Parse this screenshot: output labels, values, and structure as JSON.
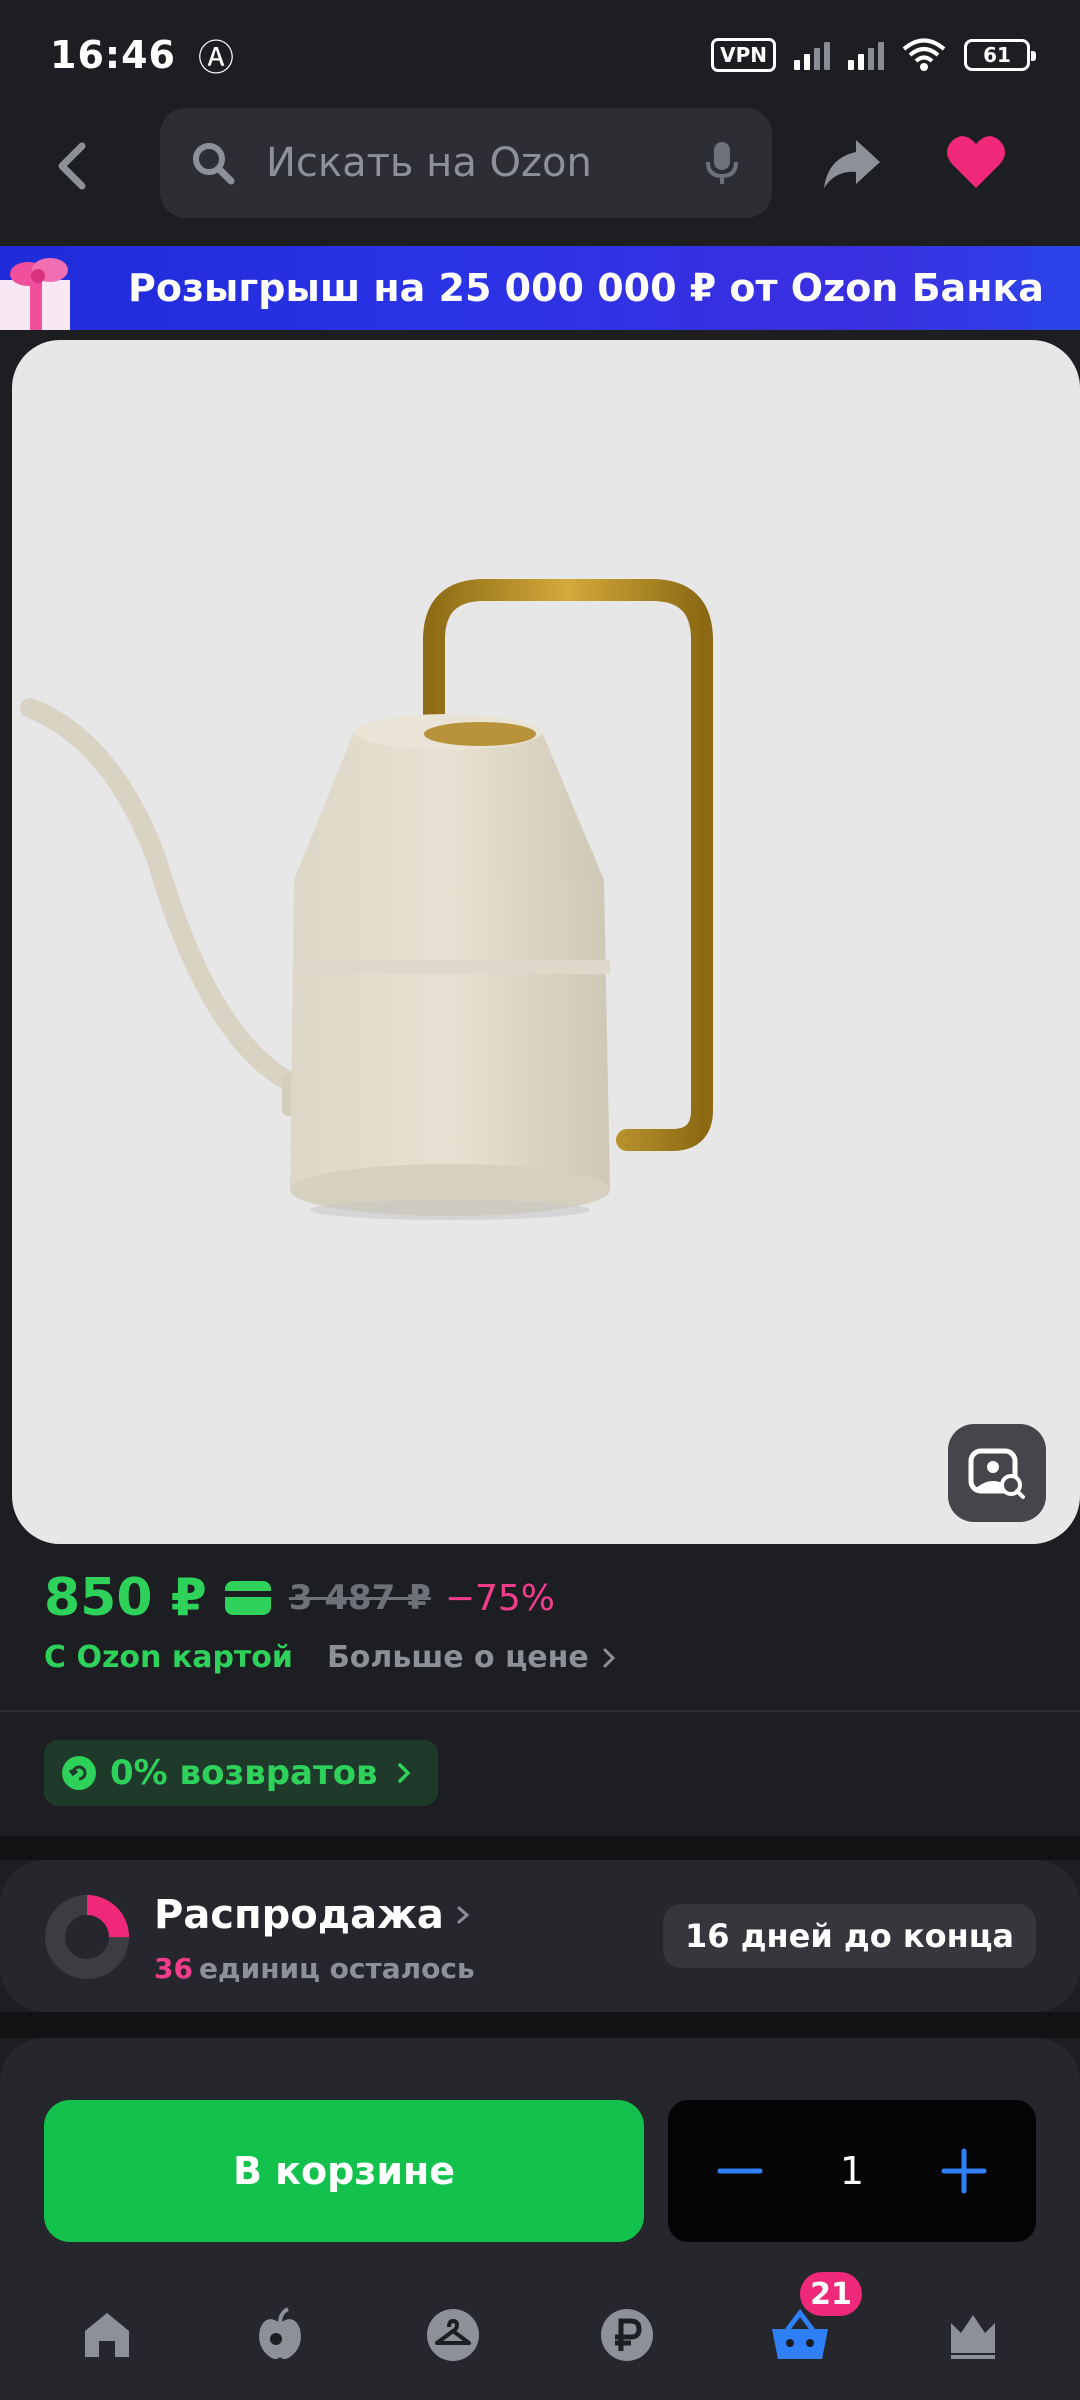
{
  "status_bar": {
    "time": "16:46",
    "vpn": "VPN",
    "battery": "61"
  },
  "search": {
    "placeholder": "Искать на Ozon"
  },
  "promo": {
    "text": "Розыгрыш на 25 000 000 ₽ от Ozon Банка"
  },
  "price": {
    "current": "850 ₽",
    "old": "3 487 ₽",
    "discount": "−75%",
    "card_label": "С Ozon картой",
    "more_label": "Больше о цене"
  },
  "returns": {
    "label": "0% возвратов"
  },
  "sale": {
    "title": "Распродажа",
    "left_count": "36",
    "left_text": "единиц осталось",
    "days": "16 дней до конца",
    "progress_fraction": 0.25
  },
  "cart": {
    "button_label": "В корзине",
    "quantity": "1"
  },
  "tab_bar": {
    "cart_badge": "21",
    "items": [
      "home",
      "fresh",
      "favorites",
      "finance",
      "cart",
      "premium"
    ]
  },
  "colors": {
    "accent_green": "#2ed15a",
    "cart_button": "#12c24d",
    "discount_pink": "#f23d8c",
    "link_blue": "#2f80f7",
    "background": "#1c1e22"
  }
}
